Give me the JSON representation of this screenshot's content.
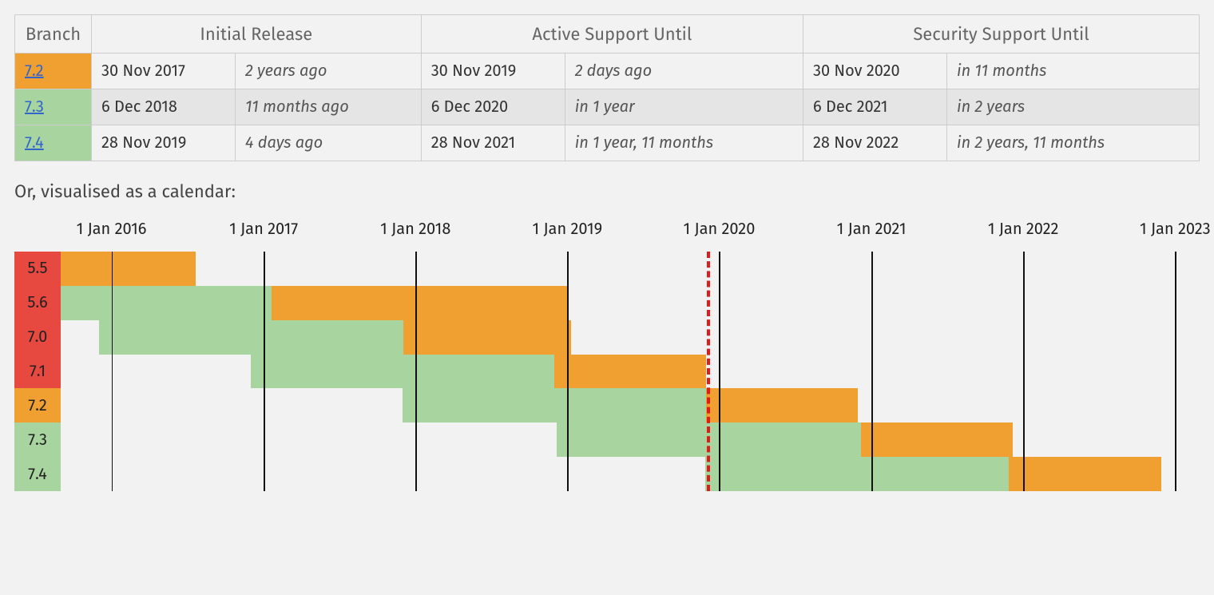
{
  "table": {
    "headers": {
      "branch": "Branch",
      "initial": "Initial Release",
      "active": "Active Support Until",
      "security": "Security Support Until"
    },
    "rows": [
      {
        "version": "7.2",
        "branch_cell_class": "bg-orange",
        "initial_date": "30 Nov 2017",
        "initial_rel": "2 years ago",
        "active_date": "30 Nov 2019",
        "active_rel": "2 days ago",
        "security_date": "30 Nov 2020",
        "security_rel": "in 11 months",
        "alt": false
      },
      {
        "version": "7.3",
        "branch_cell_class": "bg-green",
        "initial_date": "6 Dec 2018",
        "initial_rel": "11 months ago",
        "active_date": "6 Dec 2020",
        "active_rel": "in 1 year",
        "security_date": "6 Dec 2021",
        "security_rel": "in 2 years",
        "alt": true
      },
      {
        "version": "7.4",
        "branch_cell_class": "bg-green",
        "initial_date": "28 Nov 2019",
        "initial_rel": "4 days ago",
        "active_date": "28 Nov 2021",
        "active_rel": "in 1 year, 11 months",
        "security_date": "28 Nov 2022",
        "security_rel": "in 2 years, 11 months",
        "alt": false
      }
    ]
  },
  "caption": "Or, visualised as a calendar:",
  "chart_data": {
    "type": "gantt",
    "title": "",
    "x_axis": {
      "min": "2015-09-01",
      "max": "2023-03-01",
      "ticks": [
        "1 Jan 2016",
        "1 Jan 2017",
        "1 Jan 2018",
        "1 Jan 2019",
        "1 Jan 2020",
        "1 Jan 2021",
        "1 Jan 2022",
        "1 Jan 2023"
      ],
      "tick_dates": [
        "2016-01-01",
        "2017-01-01",
        "2018-01-01",
        "2019-01-01",
        "2020-01-01",
        "2021-01-01",
        "2022-01-01",
        "2023-01-01"
      ]
    },
    "today": "2019-12-02",
    "colors": {
      "active": "#a7d49f",
      "security": "#f0a030",
      "eol_label": "#e74840"
    },
    "series": [
      {
        "name": "5.5",
        "label_color": "eol_label",
        "segments": [
          {
            "kind": "security",
            "start": "2015-09-01",
            "end": "2016-07-21"
          }
        ]
      },
      {
        "name": "5.6",
        "label_color": "eol_label",
        "segments": [
          {
            "kind": "active",
            "start": "2015-09-01",
            "end": "2017-01-19"
          },
          {
            "kind": "security",
            "start": "2017-01-19",
            "end": "2018-12-31"
          }
        ]
      },
      {
        "name": "7.0",
        "label_color": "eol_label",
        "segments": [
          {
            "kind": "active",
            "start": "2015-12-03",
            "end": "2017-12-03"
          },
          {
            "kind": "security",
            "start": "2017-12-03",
            "end": "2019-01-10"
          }
        ]
      },
      {
        "name": "7.1",
        "label_color": "eol_label",
        "segments": [
          {
            "kind": "active",
            "start": "2016-12-01",
            "end": "2018-12-01"
          },
          {
            "kind": "security",
            "start": "2018-12-01",
            "end": "2019-12-01"
          }
        ]
      },
      {
        "name": "7.2",
        "label_color": "security",
        "segments": [
          {
            "kind": "active",
            "start": "2017-11-30",
            "end": "2019-11-30"
          },
          {
            "kind": "security",
            "start": "2019-11-30",
            "end": "2020-11-30"
          }
        ]
      },
      {
        "name": "7.3",
        "label_color": "active",
        "segments": [
          {
            "kind": "active",
            "start": "2018-12-06",
            "end": "2020-12-06"
          },
          {
            "kind": "security",
            "start": "2020-12-06",
            "end": "2021-12-06"
          }
        ]
      },
      {
        "name": "7.4",
        "label_color": "active",
        "segments": [
          {
            "kind": "active",
            "start": "2019-11-28",
            "end": "2021-11-28"
          },
          {
            "kind": "security",
            "start": "2021-11-28",
            "end": "2022-11-28"
          }
        ]
      }
    ]
  }
}
